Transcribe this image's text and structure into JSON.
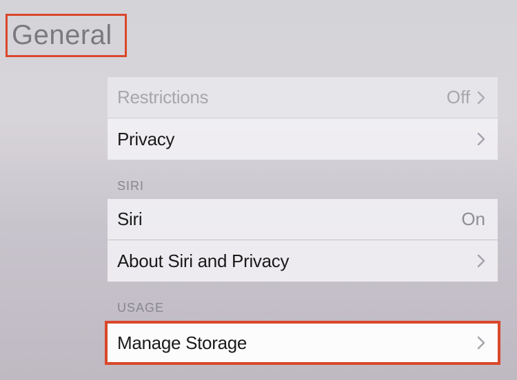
{
  "title": "General",
  "groups": [
    {
      "header": null,
      "rows": [
        {
          "label": "Restrictions",
          "value": "Off",
          "has_chevron": true,
          "faded": true
        },
        {
          "label": "Privacy",
          "value": null,
          "has_chevron": true,
          "faded": false
        }
      ]
    },
    {
      "header": "SIRI",
      "rows": [
        {
          "label": "Siri",
          "value": "On",
          "has_chevron": false,
          "faded": false
        },
        {
          "label": "About Siri and Privacy",
          "value": null,
          "has_chevron": true,
          "faded": false
        }
      ]
    },
    {
      "header": "USAGE",
      "rows": [
        {
          "label": "Manage Storage",
          "value": null,
          "has_chevron": true,
          "faded": false,
          "highlight": true
        }
      ]
    }
  ]
}
